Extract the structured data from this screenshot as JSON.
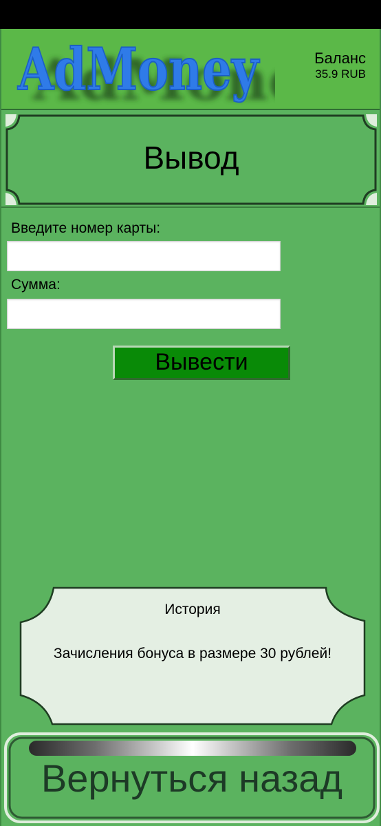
{
  "header": {
    "logo_text": "AdMoney",
    "balance_title": "Баланс",
    "balance_value": "35.9  RUB"
  },
  "page": {
    "title": "Вывод"
  },
  "form": {
    "card_label": "Введите номер карты:",
    "card_value": "",
    "amount_label": "Сумма:",
    "amount_value": "",
    "submit_label": "Вывести"
  },
  "history": {
    "title": "История",
    "items": [
      "Зачисления бонуса в размере 30 рублей!"
    ]
  },
  "footer": {
    "back_label": "Вернуться назад"
  },
  "colors": {
    "background": "#5bb35f",
    "header": "#5bb848",
    "logo": "#2f7be8",
    "submit": "#098a07",
    "history_panel": "#e4efe3"
  }
}
